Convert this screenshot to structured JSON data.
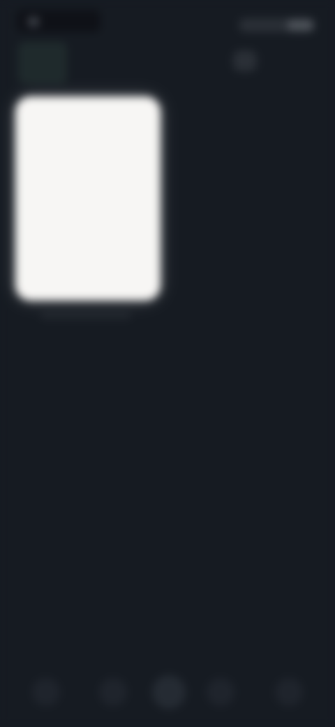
{
  "screen": {
    "background": "#161b22",
    "card_color": "#f7f6f4"
  },
  "status_bar": {
    "icons": [
      "time-chip",
      "status-indicators"
    ]
  },
  "top": {
    "left_thumbnail_icon": "app-thumbnail-icon",
    "right_icon": "action-icon"
  },
  "card": {
    "caption": ""
  },
  "bottom_nav": {
    "items": [
      {
        "icon": "nav-icon-1"
      },
      {
        "icon": "nav-icon-2"
      },
      {
        "icon": "nav-icon-center"
      },
      {
        "icon": "nav-icon-4"
      },
      {
        "icon": "nav-icon-5"
      }
    ]
  }
}
